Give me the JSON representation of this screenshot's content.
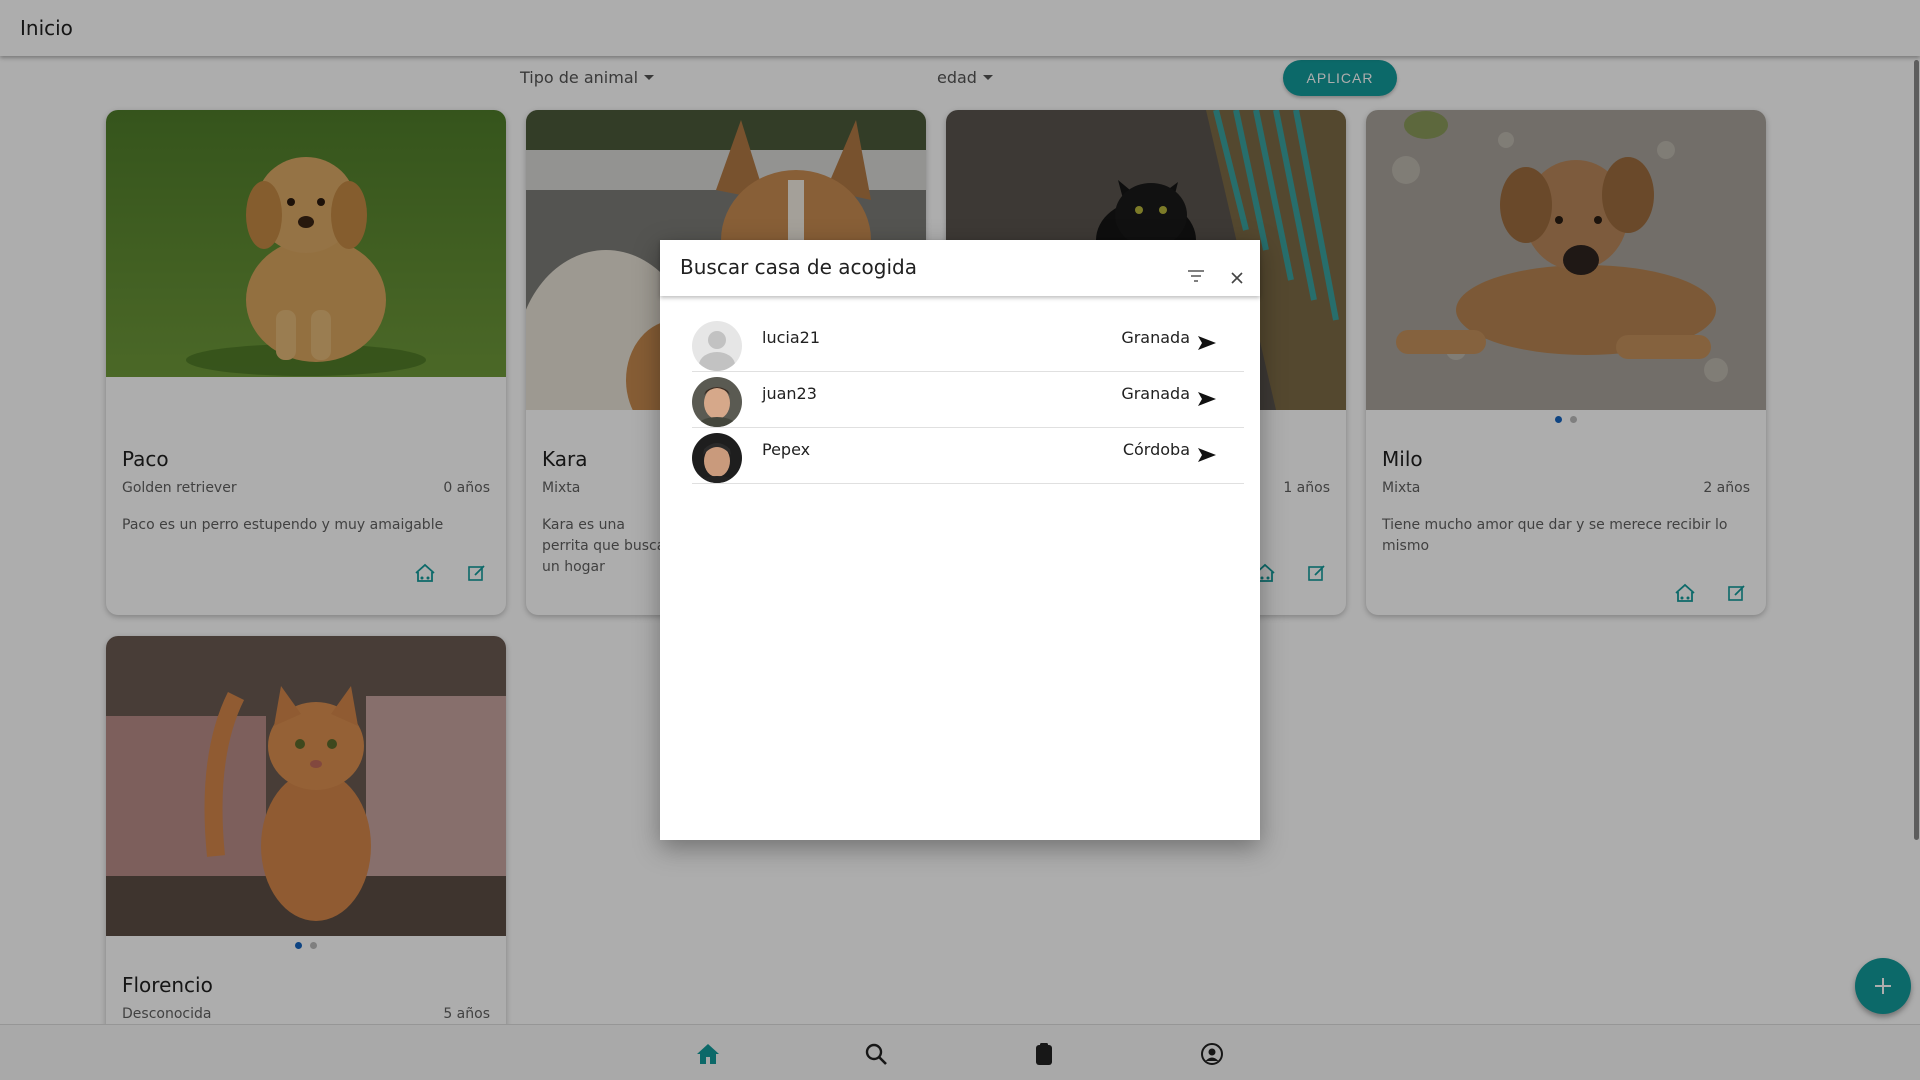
{
  "header": {
    "title": "Inicio"
  },
  "filters": {
    "animal_type_label": "Tipo de animal",
    "age_label": "edad",
    "apply_label": "APLICAR"
  },
  "cards": [
    {
      "name": "Paco",
      "breed": "Golden retriever",
      "age": "0 años",
      "description": "Paco es un perro estupendo y muy amaigable"
    },
    {
      "name": "Kara",
      "breed": "Mixta",
      "age": "",
      "description": "Kara es una perrita que busca un hogar"
    },
    {
      "name": "",
      "breed": "",
      "age": "1 años",
      "description": ""
    },
    {
      "name": "Milo",
      "breed": "Mixta",
      "age": "2 años",
      "description": "Tiene mucho amor que dar y se merece recibir lo mismo"
    },
    {
      "name": "Florencio",
      "breed": "Desconocida",
      "age": "5 años",
      "description": ""
    }
  ],
  "modal": {
    "title": "Buscar casa de acogida",
    "filter_icon": "filter-list-icon",
    "close_icon": "close-icon",
    "users": [
      {
        "username": "lucia21",
        "city": "Granada"
      },
      {
        "username": "juan23",
        "city": "Granada"
      },
      {
        "username": "Pepex",
        "city": "Córdoba"
      }
    ]
  },
  "bottom_nav": {
    "items": [
      "home-icon",
      "search-icon",
      "clipboard-icon",
      "account-icon"
    ]
  },
  "colors": {
    "accent": "#139b9b",
    "dot_active": "#1565c0"
  }
}
